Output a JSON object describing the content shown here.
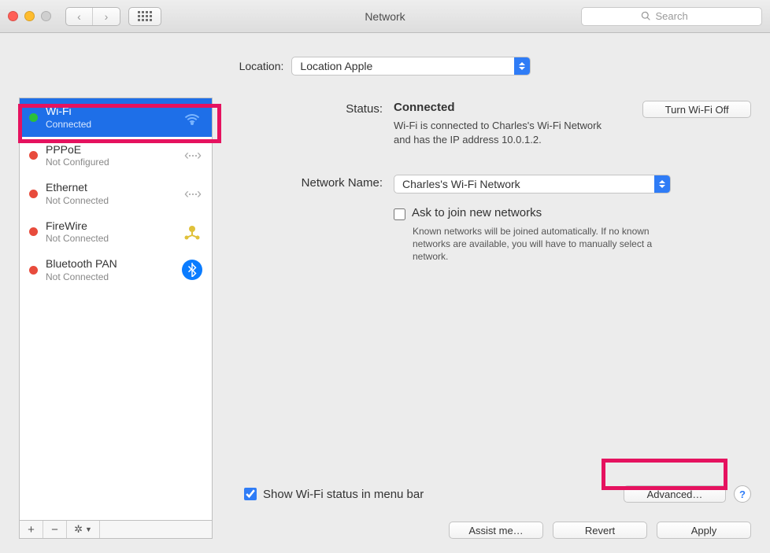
{
  "window": {
    "title": "Network",
    "search_placeholder": "Search"
  },
  "location": {
    "label": "Location:",
    "selected": "Location Apple"
  },
  "services": [
    {
      "name": "Wi-Fi",
      "status": "Connected",
      "dot": "green",
      "icon": "wifi",
      "selected": true
    },
    {
      "name": "PPPoE",
      "status": "Not Configured",
      "dot": "red",
      "icon": "eth",
      "selected": false
    },
    {
      "name": "Ethernet",
      "status": "Not Connected",
      "dot": "red",
      "icon": "eth",
      "selected": false
    },
    {
      "name": "FireWire",
      "status": "Not Connected",
      "dot": "red",
      "icon": "firewire",
      "selected": false
    },
    {
      "name": "Bluetooth PAN",
      "status": "Not Connected",
      "dot": "red",
      "icon": "bluetooth",
      "selected": false
    }
  ],
  "toolbar": {
    "add": "+",
    "remove": "−",
    "gear": "✱▾"
  },
  "panel": {
    "status_label": "Status:",
    "status_value": "Connected",
    "wifi_off_btn": "Turn Wi-Fi Off",
    "status_desc": "Wi-Fi is connected to Charles's Wi-Fi Network and has the IP address 10.0.1.2.",
    "network_name_label": "Network Name:",
    "network_name_value": "Charles's Wi-Fi Network",
    "ask_join_label": "Ask to join new networks",
    "ask_join_desc": "Known networks will be joined automatically. If no known networks are available, you will have to manually select a network.",
    "show_menubar_label": "Show Wi-Fi status in menu bar",
    "advanced_btn": "Advanced…",
    "help": "?"
  },
  "footer": {
    "assist": "Assist me…",
    "revert": "Revert",
    "apply": "Apply"
  },
  "highlights": {
    "sidebar_wifi": true,
    "advanced_button": true
  }
}
